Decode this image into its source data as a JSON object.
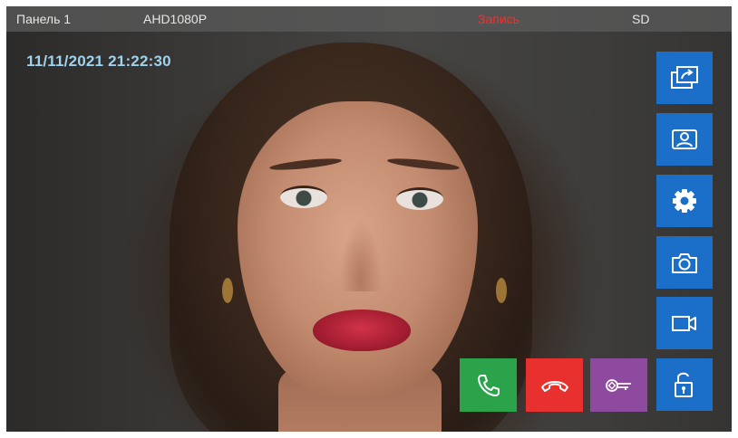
{
  "status_bar": {
    "panel": "Панель 1",
    "camera": "AHD1080P",
    "recording": "Запись",
    "storage": "SD"
  },
  "datetime": "11/11/2021 21:22:30",
  "colors": {
    "status_text": "#e6e6e6",
    "recording_text": "#ff2a2a",
    "datetime_text": "#9fd2ec",
    "side_button": "#1b6fc8",
    "answer_button": "#2aa34a",
    "hangup_button": "#e8312f",
    "key_button": "#8d4a9e"
  },
  "side_buttons": [
    {
      "icon": "switch-screen-icon"
    },
    {
      "icon": "contact-photo-icon"
    },
    {
      "icon": "gear-icon"
    },
    {
      "icon": "camera-icon"
    },
    {
      "icon": "video-camera-icon"
    },
    {
      "icon": "unlock-icon"
    }
  ],
  "action_buttons": [
    {
      "icon": "phone-answer-icon"
    },
    {
      "icon": "phone-hangup-icon"
    },
    {
      "icon": "key-icon"
    }
  ]
}
